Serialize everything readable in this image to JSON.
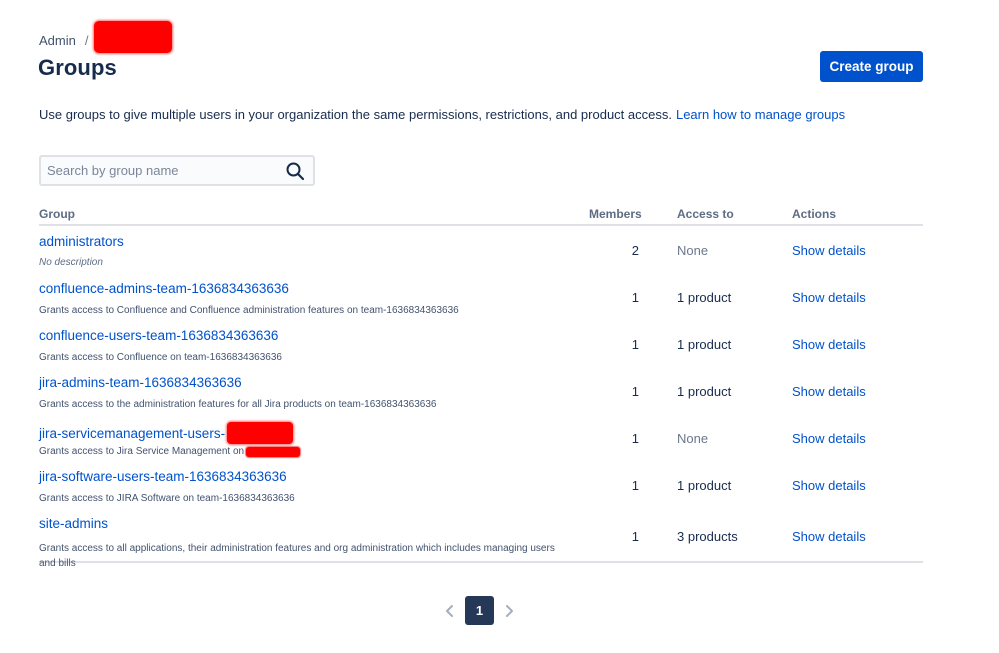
{
  "breadcrumb": {
    "root": "Admin",
    "separator": "/"
  },
  "page": {
    "title": "Groups",
    "create_button": "Create group",
    "intro": "Use groups to give multiple users in your organization the same permissions, restrictions, and product access.",
    "learn_link": "Learn how to manage groups"
  },
  "search": {
    "placeholder": "Search by group name",
    "value": "",
    "icon": "search-icon"
  },
  "table": {
    "headers": {
      "group": "Group",
      "members": "Members",
      "access": "Access to",
      "actions": "Actions"
    },
    "rows": [
      {
        "name": "administrators",
        "description": "No description",
        "members": "2",
        "access": "None",
        "action": "Show details"
      },
      {
        "name": "confluence-admins-team-1636834363636",
        "description": "Grants access to Confluence and Confluence administration features on team-1636834363636",
        "members": "1",
        "access": "1 product",
        "action": "Show details"
      },
      {
        "name": "confluence-users-team-1636834363636",
        "description": "Grants access to Confluence on team-1636834363636",
        "members": "1",
        "access": "1 product",
        "action": "Show details"
      },
      {
        "name": "jira-admins-team-1636834363636",
        "description": "Grants access to the administration features for all Jira products on team-1636834363636",
        "members": "1",
        "access": "1 product",
        "action": "Show details"
      },
      {
        "name": "jira-servicemanagement-users-",
        "description": "Grants access to Jira Service Management on",
        "members": "1",
        "access": "None",
        "action": "Show details"
      },
      {
        "name": "jira-software-users-team-1636834363636",
        "description": "Grants access to JIRA Software on team-1636834363636",
        "members": "1",
        "access": "1 product",
        "action": "Show details"
      },
      {
        "name": "site-admins",
        "description": "Grants access to all applications, their administration features and org administration which includes managing users and bills",
        "members": "1",
        "access": "3 products",
        "action": "Show details"
      }
    ]
  },
  "pagination": {
    "current": "1",
    "prev_icon": "chevron-left-icon",
    "next_icon": "chevron-right-icon"
  },
  "colors": {
    "primary": "#0052cc",
    "text": "#172b4d",
    "subtle": "#6b778c",
    "redaction": "#ff0000",
    "pager_active": "#253858"
  }
}
